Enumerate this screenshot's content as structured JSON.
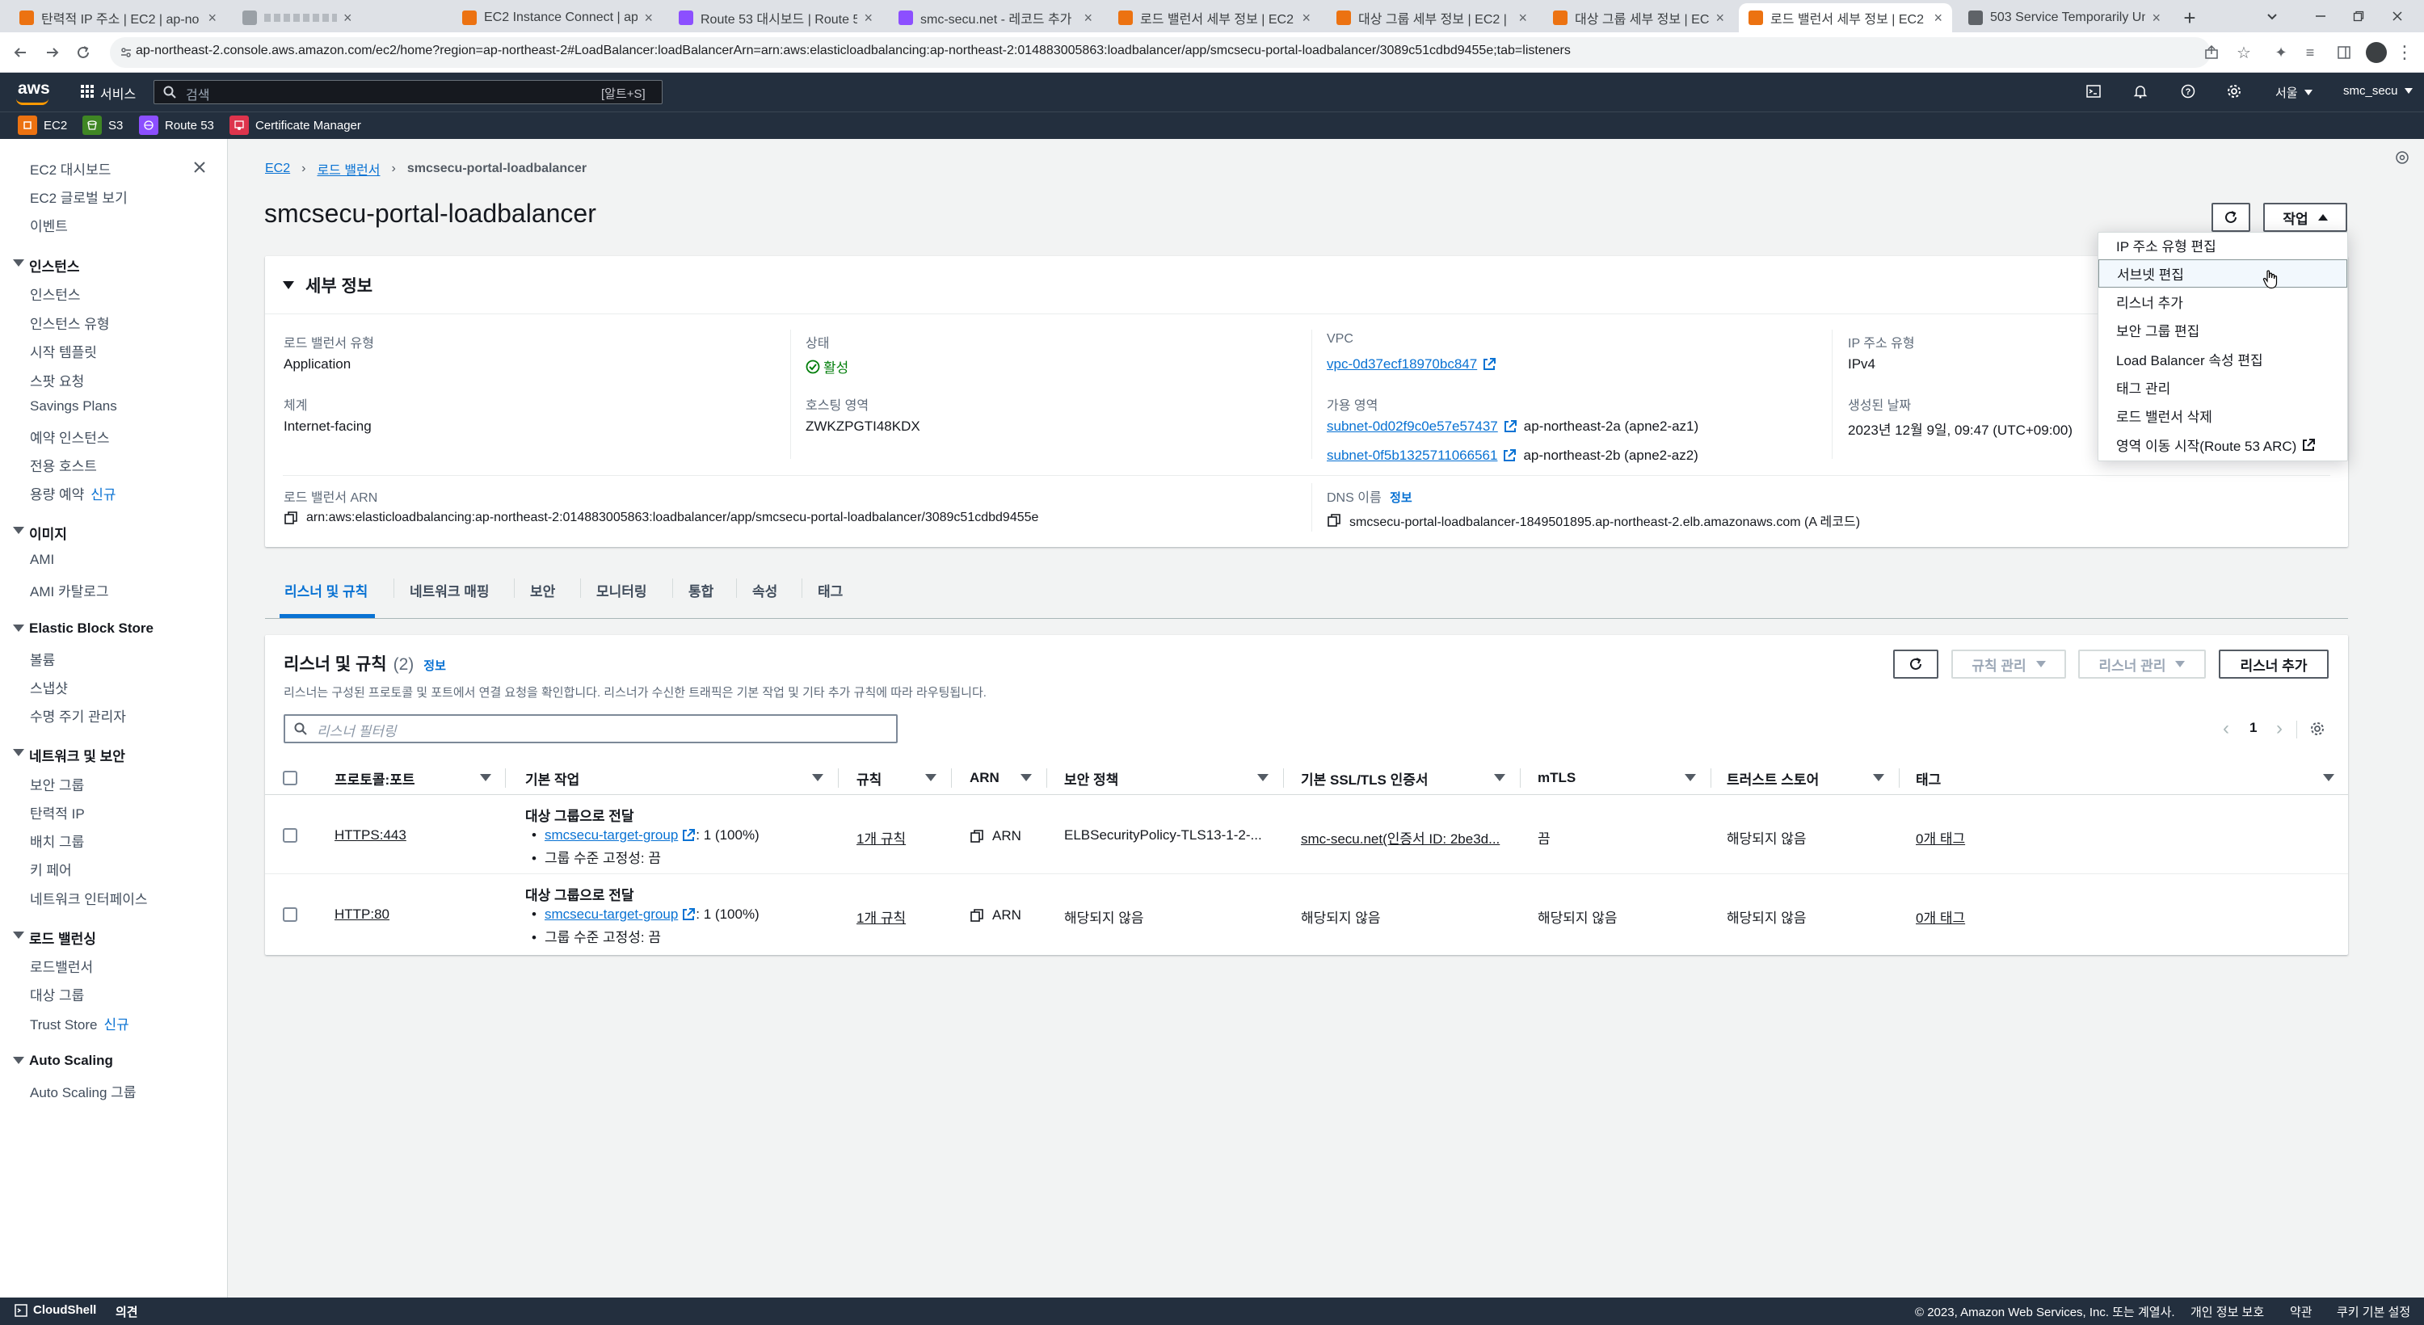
{
  "browser": {
    "tabs": [
      {
        "label": "탄력적 IP 주소 | EC2 | ap-no",
        "fav": "#ec7211"
      },
      {
        "label": "",
        "fav": "#9aa0a6"
      },
      {
        "label": "EC2 Instance Connect | ap-n",
        "fav": "#ec7211"
      },
      {
        "label": "Route 53 대시보드 | Route 5",
        "fav": "#8c4fff"
      },
      {
        "label": "smc-secu.net - 레코드 추가",
        "fav": "#8c4fff"
      },
      {
        "label": "로드 밸런서 세부 정보 | EC2",
        "fav": "#ec7211"
      },
      {
        "label": "대상 그룹 세부 정보 | EC2 |",
        "fav": "#ec7211"
      },
      {
        "label": "대상 그룹 세부 정보 | EC2 |",
        "fav": "#ec7211"
      },
      {
        "label": "로드 밸런서 세부 정보 | EC2",
        "fav": "#ec7211"
      },
      {
        "label": "503 Service Temporarily Unav",
        "fav": "#5f6368"
      }
    ],
    "url": "ap-northeast-2.console.aws.amazon.com/ec2/home?region=ap-northeast-2#LoadBalancer:loadBalancerArn=arn:aws:elasticloadbalancing:ap-northeast-2:014883005863:loadbalancer/app/smcsecu-portal-loadbalancer/3089c51cdbd9455e;tab=listeners"
  },
  "aws_header": {
    "logo": "aws",
    "services": "서비스",
    "search_placeholder": "검색",
    "search_shortcut": "[알트+S]",
    "region": "서울",
    "account": "smc_secu"
  },
  "favorites": [
    "EC2",
    "S3",
    "Route 53",
    "Certificate Manager"
  ],
  "colors": {
    "ec2": "#ec7211",
    "s3": "#3f8624",
    "route53": "#8c4fff",
    "acm": "#dd344c",
    "link": "#0972d3",
    "success": "#037f0c"
  },
  "sidenav": {
    "top": [
      "EC2 대시보드",
      "EC2 글로벌 보기",
      "이벤트"
    ],
    "instances": {
      "title": "인스턴스",
      "items": [
        "인스턴스",
        "인스턴스 유형",
        "시작 템플릿",
        "스팟 요청",
        "Savings Plans",
        "예약 인스턴스",
        "전용 호스트",
        "용량 예약"
      ]
    },
    "images": {
      "title": "이미지",
      "items": [
        "AMI",
        "AMI 카탈로그"
      ]
    },
    "ebs": {
      "title": "Elastic Block Store",
      "items": [
        "볼륨",
        "스냅샷",
        "수명 주기 관리자"
      ]
    },
    "network": {
      "title": "네트워크 및 보안",
      "items": [
        "보안 그룹",
        "탄력적 IP",
        "배치 그룹",
        "키 페어",
        "네트워크 인터페이스"
      ]
    },
    "lb": {
      "title": "로드 밸런싱",
      "items": [
        "로드밸런서",
        "대상 그룹",
        "Trust Store"
      ]
    },
    "asg": {
      "title": "Auto Scaling",
      "items": [
        "Auto Scaling 그룹"
      ]
    },
    "new_label": "신규"
  },
  "breadcrumb": {
    "ec2": "EC2",
    "lbs": "로드 밸런서",
    "current": "smcsecu-portal-loadbalancer"
  },
  "page_title": "smcsecu-portal-loadbalancer",
  "actions_label": "작업",
  "actions_menu": [
    "IP 주소 유형 편집",
    "서브넷 편집",
    "리스너 추가",
    "보안 그룹 편집",
    "Load Balancer 속성 편집",
    "태그 관리",
    "로드 밸런서 삭제",
    "영역 이동 시작(Route 53 ARC)"
  ],
  "details": {
    "title": "세부 정보",
    "lb_type_label": "로드 밸런서 유형",
    "lb_type": "Application",
    "scheme_label": "체계",
    "scheme": "Internet-facing",
    "state_label": "상태",
    "state": "활성",
    "hosted_zone_label": "호스팅 영역",
    "hosted_zone": "ZWKZPGTI48KDX",
    "vpc_label": "VPC",
    "vpc": "vpc-0d37ecf18970bc847",
    "az_label": "가용 영역",
    "subnet1": "subnet-0d02f9c0e57e57437",
    "az1": "ap-northeast-2a (apne2-az1)",
    "subnet2": "subnet-0f5b1325711066561",
    "az2": "ap-northeast-2b (apne2-az2)",
    "ip_type_label": "IP 주소 유형",
    "ip_type": "IPv4",
    "created_label": "생성된 날짜",
    "created": "2023년 12월 9일, 09:47 (UTC+09:00)",
    "arn_label": "로드 밸런서 ARN",
    "arn": "arn:aws:elasticloadbalancing:ap-northeast-2:014883005863:loadbalancer/app/smcsecu-portal-loadbalancer/3089c51cdbd9455e",
    "dns_label": "DNS 이름",
    "dns_info": "정보",
    "dns": "smcsecu-portal-loadbalancer-1849501895.ap-northeast-2.elb.amazonaws.com (A 레코드)"
  },
  "detail_tabs": [
    "리스너 및 규칙",
    "네트워크 매핑",
    "보안",
    "모니터링",
    "통합",
    "속성",
    "태그"
  ],
  "listeners": {
    "title": "리스너 및 규칙",
    "count": "(2)",
    "info": "정보",
    "desc": "리스너는 구성된 프로토콜 및 포트에서 연결 요청을 확인합니다. 리스너가 수신한 트래픽은 기본 작업 및 기타 추가 규칙에 따라 라우팅됩니다.",
    "filter_placeholder": "리스너 필터링",
    "manage_rules": "규칙 관리",
    "manage_listeners": "리스너 관리",
    "add_listener": "리스너 추가",
    "page": "1",
    "columns": [
      "프로토콜:포트",
      "기본 작업",
      "규칙",
      "ARN",
      "보안 정책",
      "기본 SSL/TLS 인증서",
      "mTLS",
      "트러스트 스토어",
      "태그"
    ],
    "rows": [
      {
        "protocol": "HTTPS:443",
        "action_title": "대상 그룹으로 전달",
        "tg": "smcsecu-target-group",
        "tg_weight": ": 1 (100%)",
        "stickiness": "그룹 수준 고정성: 끔",
        "rules": "1개 규칙",
        "arn": "ARN",
        "policy": "ELBSecurityPolicy-TLS13-1-2-...",
        "cert": "smc-secu.net(인증서 ID: 2be3d...",
        "mtls": "끔",
        "trust": "해당되지 않음",
        "tags": "0개 태그"
      },
      {
        "protocol": "HTTP:80",
        "action_title": "대상 그룹으로 전달",
        "tg": "smcsecu-target-group",
        "tg_weight": ": 1 (100%)",
        "stickiness": "그룹 수준 고정성: 끔",
        "rules": "1개 규칙",
        "arn": "ARN",
        "policy": "해당되지 않음",
        "cert": "해당되지 않음",
        "mtls": "해당되지 않음",
        "trust": "해당되지 않음",
        "tags": "0개 태그"
      }
    ]
  },
  "footer": {
    "cloudshell": "CloudShell",
    "feedback": "의견",
    "copyright": "© 2023, Amazon Web Services, Inc. 또는 계열사.",
    "privacy": "개인 정보 보호",
    "terms": "약관",
    "cookies": "쿠키 기본 설정"
  }
}
